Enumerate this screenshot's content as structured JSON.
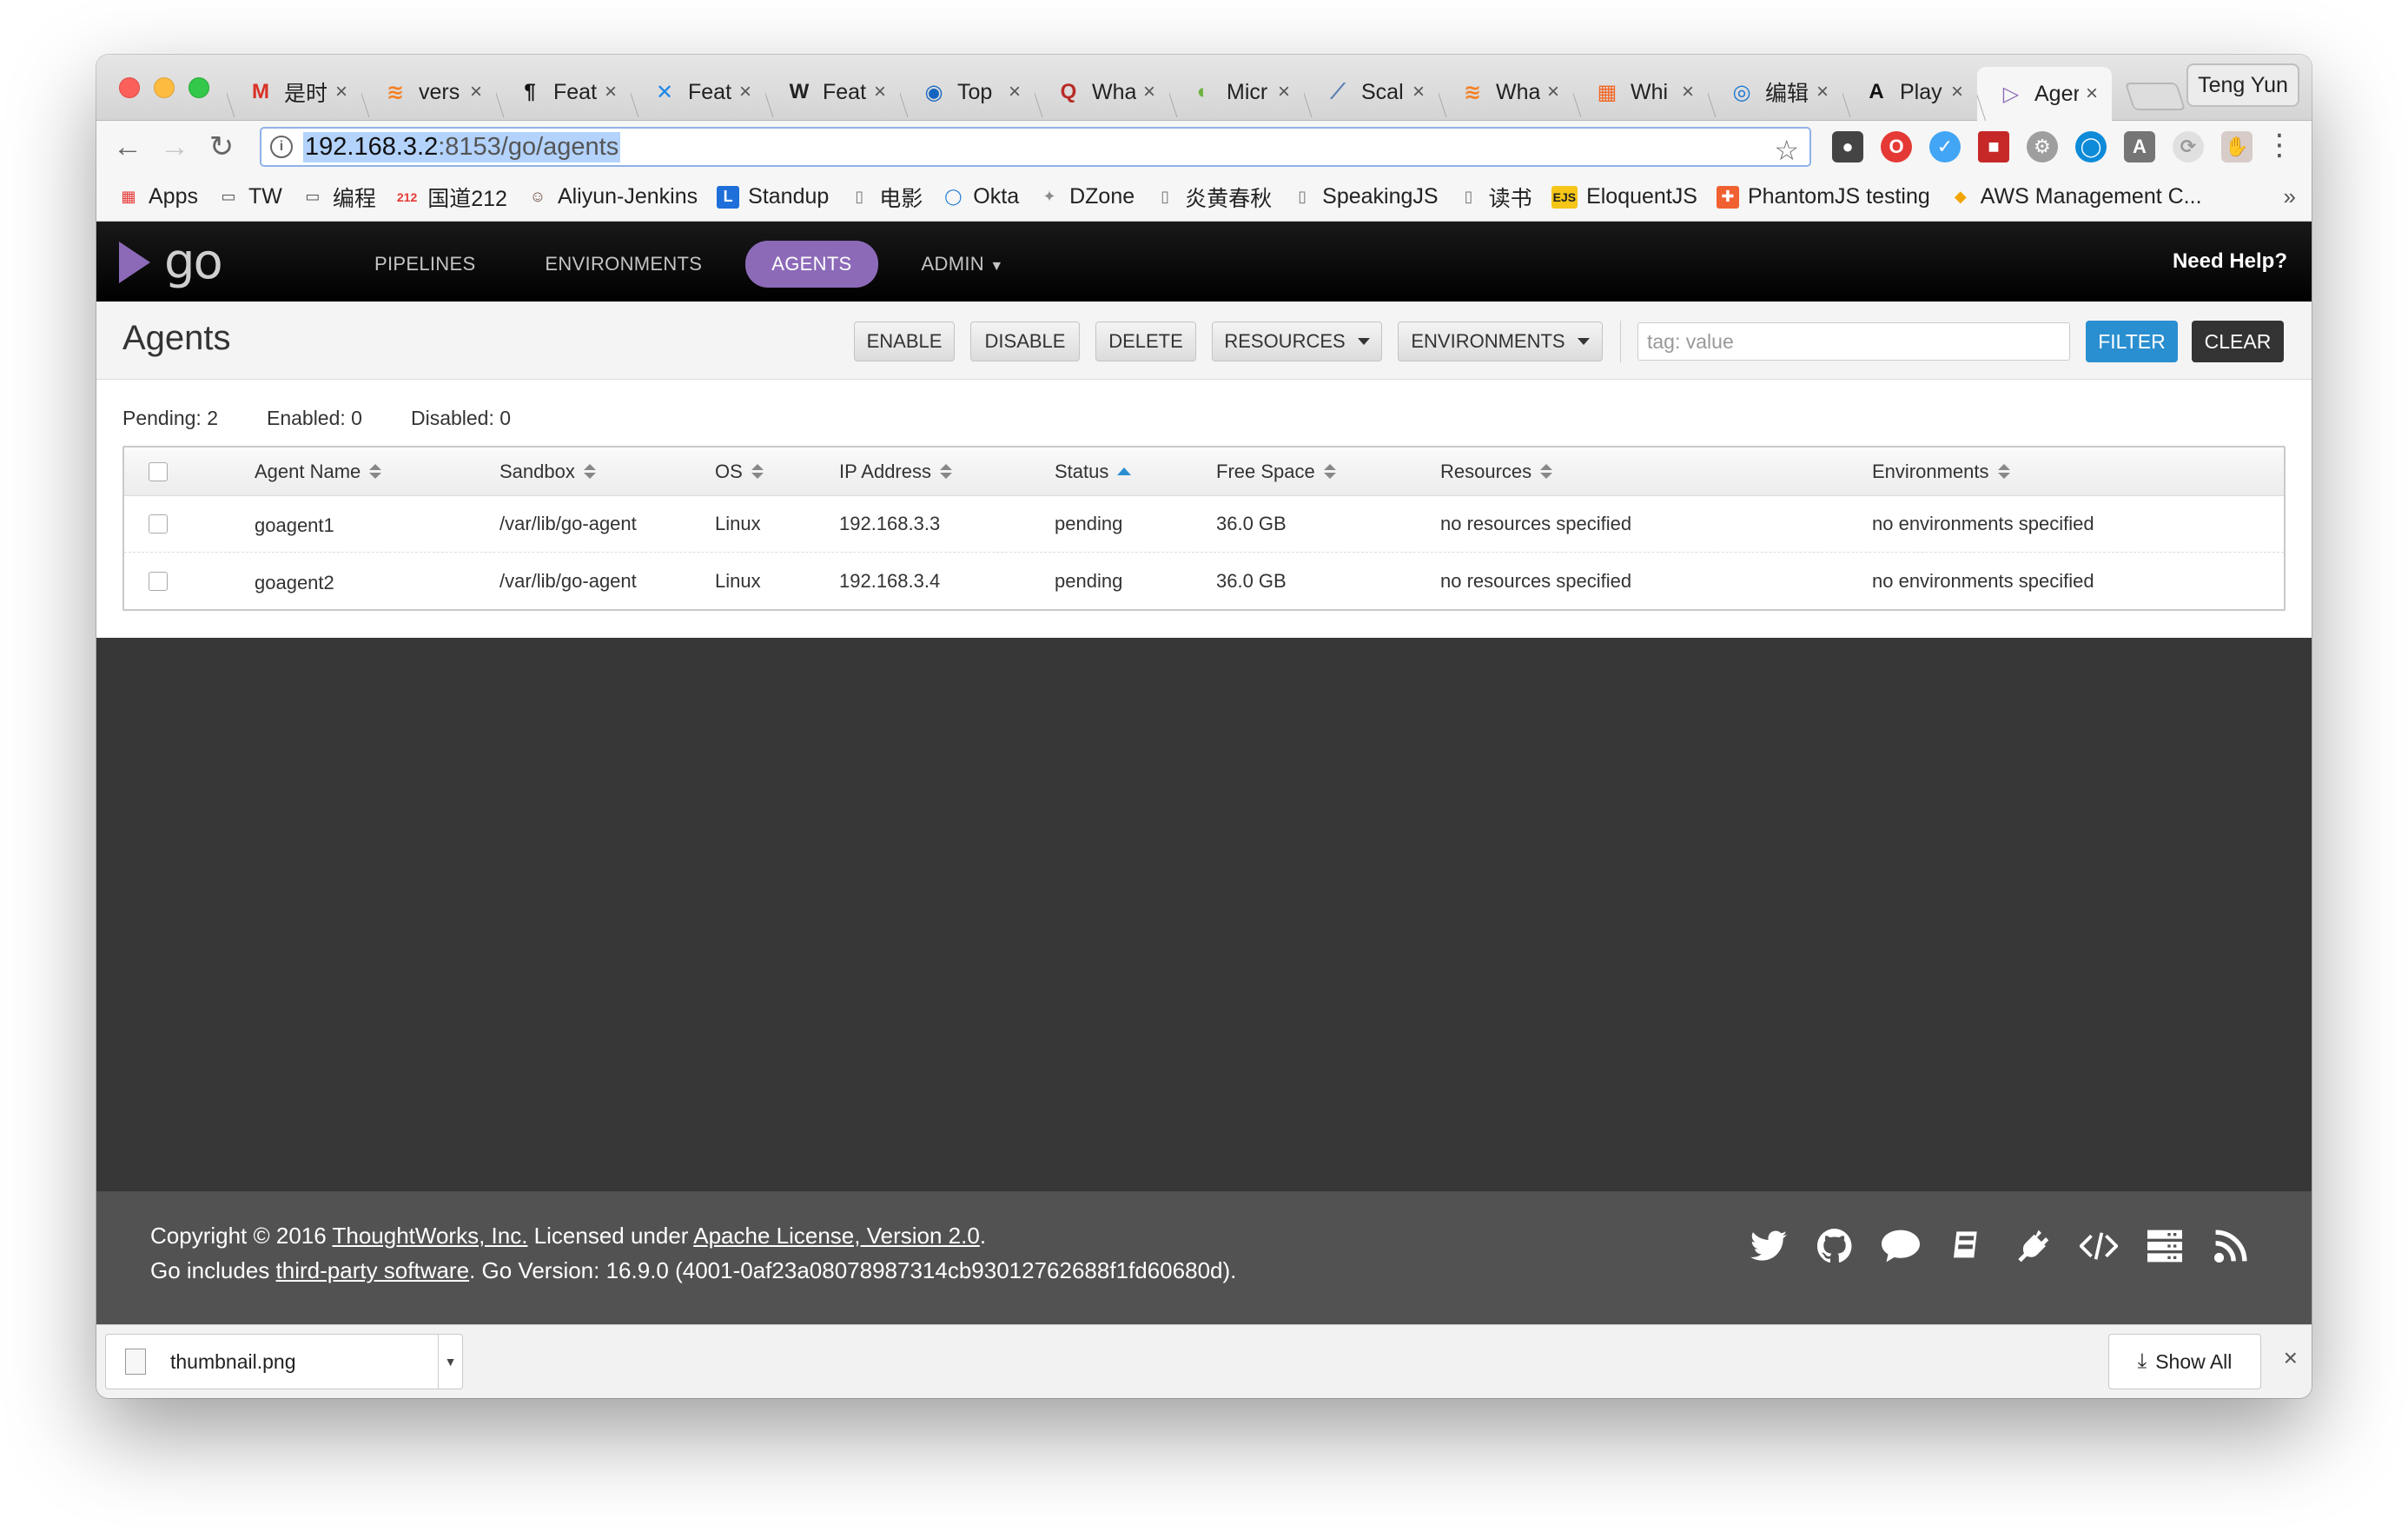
{
  "browser": {
    "tabs": [
      {
        "title": "是时",
        "icon": "gmail-icon",
        "glyph": "M",
        "color": "#d93025"
      },
      {
        "title": "vers",
        "icon": "stackoverflow-icon",
        "glyph": "≋",
        "color": "#f48024"
      },
      {
        "title": "Feat",
        "icon": "pilcrow-icon",
        "glyph": "¶",
        "color": "#111"
      },
      {
        "title": "Feat",
        "icon": "jasmine-icon",
        "glyph": "✕",
        "color": "#1e88e5"
      },
      {
        "title": "Feat",
        "icon": "wikipedia-icon",
        "glyph": "W",
        "color": "#222"
      },
      {
        "title": "Top",
        "icon": "globe-icon",
        "glyph": "◉",
        "color": "#1565c0"
      },
      {
        "title": "Wha",
        "icon": "quora-icon",
        "glyph": "Q",
        "color": "#b92b27"
      },
      {
        "title": "Micr",
        "icon": "spring-icon",
        "glyph": "◐",
        "color": "#6db33f"
      },
      {
        "title": "Scal",
        "icon": "scala-icon",
        "glyph": "⟋",
        "color": "#5a7fb5"
      },
      {
        "title": "Wha",
        "icon": "stackoverflow-icon",
        "glyph": "≋",
        "color": "#f48024"
      },
      {
        "title": "Whi",
        "icon": "grid-icon",
        "glyph": "▦",
        "color": "#f26522"
      },
      {
        "title": "编辑",
        "icon": "edit-icon",
        "glyph": "◎",
        "color": "#1976d2"
      },
      {
        "title": "Play",
        "icon": "angular-a-icon",
        "glyph": "A",
        "color": "#111"
      },
      {
        "title": "Ager",
        "icon": "gocd-icon",
        "glyph": "▷",
        "color": "#8c6ab8",
        "active": true
      }
    ],
    "profile_name": "Teng Yun",
    "url_host": "192.168.3.2",
    "url_path": ":8153/go/agents",
    "bookmarks": [
      {
        "label": "Apps",
        "icon": "apps-grid-icon"
      },
      {
        "label": "TW",
        "icon": "folder-icon"
      },
      {
        "label": "编程",
        "icon": "folder-icon"
      },
      {
        "label": "国道212",
        "icon": "road-212-icon",
        "glyph": "212"
      },
      {
        "label": "Aliyun-Jenkins",
        "icon": "jenkins-icon"
      },
      {
        "label": "Standup",
        "icon": "standup-icon"
      },
      {
        "label": "电影",
        "icon": "page-icon"
      },
      {
        "label": "Okta",
        "icon": "okta-icon"
      },
      {
        "label": "DZone",
        "icon": "dzone-icon"
      },
      {
        "label": "炎黄春秋",
        "icon": "page-icon"
      },
      {
        "label": "SpeakingJS",
        "icon": "page-icon"
      },
      {
        "label": "读书",
        "icon": "page-icon"
      },
      {
        "label": "EloquentJS",
        "icon": "ejs-icon",
        "glyph": "EJS"
      },
      {
        "label": "PhantomJS testing",
        "icon": "phantomjs-icon"
      },
      {
        "label": "AWS Management C...",
        "icon": "aws-icon"
      }
    ]
  },
  "go": {
    "logo_text": "go",
    "nav": [
      "PIPELINES",
      "ENVIRONMENTS",
      "AGENTS",
      "ADMIN"
    ],
    "need_help": "Need Help?",
    "page_title": "Agents",
    "actions": {
      "enable": "ENABLE",
      "disable": "DISABLE",
      "delete": "DELETE",
      "resources": "RESOURCES",
      "environments": "ENVIRONMENTS"
    },
    "filter_placeholder": "tag: value",
    "filter_label": "FILTER",
    "clear_label": "CLEAR",
    "summary": {
      "pending": "Pending: 2",
      "enabled": "Enabled: 0",
      "disabled": "Disabled: 0"
    },
    "columns": [
      "Agent Name",
      "Sandbox",
      "OS",
      "IP Address",
      "Status",
      "Free Space",
      "Resources",
      "Environments"
    ],
    "agents": [
      {
        "name": "goagent1",
        "sandbox": "/var/lib/go-agent",
        "os": "Linux",
        "ip": "192.168.3.3",
        "status": "pending",
        "free_space": "36.0 GB",
        "resources": "no resources specified",
        "environments": "no environments specified"
      },
      {
        "name": "goagent2",
        "sandbox": "/var/lib/go-agent",
        "os": "Linux",
        "ip": "192.168.3.4",
        "status": "pending",
        "free_space": "36.0 GB",
        "resources": "no resources specified",
        "environments": "no environments specified"
      }
    ],
    "footer": {
      "copyright_prefix": "Copyright © 2016 ",
      "company": "ThoughtWorks, Inc.",
      "licensed_under": " Licensed under ",
      "license": "Apache License, Version 2.0",
      "period": ".",
      "includes_prefix": "Go includes ",
      "third_party": "third-party software",
      "version_text": ". Go Version: 16.9.0 (4001-0af23a08078987314cb93012762688f1fd60680d)."
    }
  },
  "downloads": {
    "file": "thumbnail.png",
    "show_all": "Show All"
  },
  "colors": {
    "accent": "#8c6ab8",
    "filter_blue": "#2a8fd0"
  }
}
